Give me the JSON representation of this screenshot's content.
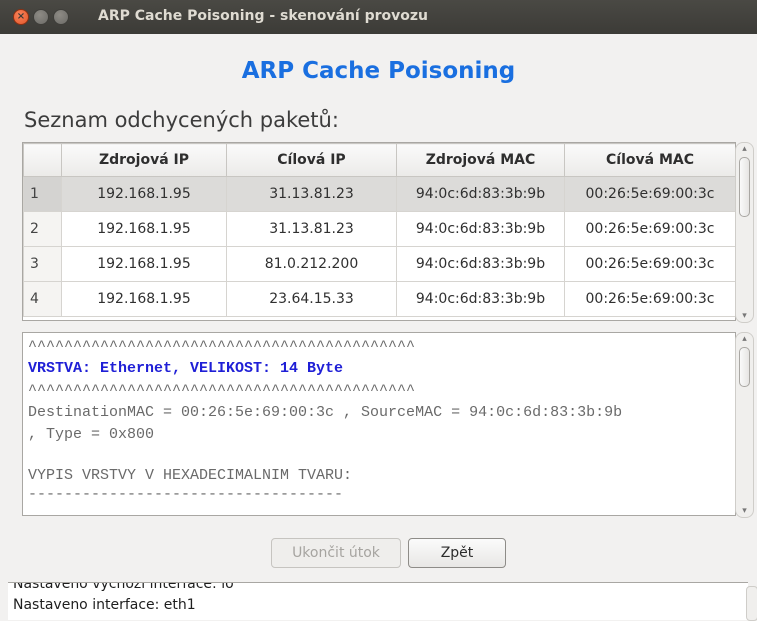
{
  "window": {
    "title": "ARP Cache Poisoning - skenování provozu",
    "close_glyph": "×"
  },
  "app_title": "ARP Cache Poisoning",
  "packets_label": "Seznam odchycených paketů:",
  "table": {
    "columns": [
      "",
      "Zdrojová IP",
      "Cílová IP",
      "Zdrojová MAC",
      "Cílová MAC"
    ],
    "rows": [
      {
        "index": "1",
        "src_ip": "192.168.1.95",
        "dst_ip": "31.13.81.23",
        "src_mac": "94:0c:6d:83:3b:9b",
        "dst_mac": "00:26:5e:69:00:3c",
        "selected": true
      },
      {
        "index": "2",
        "src_ip": "192.168.1.95",
        "dst_ip": "31.13.81.23",
        "src_mac": "94:0c:6d:83:3b:9b",
        "dst_mac": "00:26:5e:69:00:3c",
        "selected": false
      },
      {
        "index": "3",
        "src_ip": "192.168.1.95",
        "dst_ip": "81.0.212.200",
        "src_mac": "94:0c:6d:83:3b:9b",
        "dst_mac": "00:26:5e:69:00:3c",
        "selected": false
      },
      {
        "index": "4",
        "src_ip": "192.168.1.95",
        "dst_ip": "23.64.15.33",
        "src_mac": "94:0c:6d:83:3b:9b",
        "dst_mac": "00:26:5e:69:00:3c",
        "selected": false
      }
    ]
  },
  "detail": {
    "sep1": "^^^^^^^^^^^^^^^^^^^^^^^^^^^^^^^^^^^^^^^^^^^",
    "layer": "VRSTVA: Ethernet, VELIKOST: 14 Byte",
    "sep2": "^^^^^^^^^^^^^^^^^^^^^^^^^^^^^^^^^^^^^^^^^^^",
    "mac_line": "DestinationMAC = 00:26:5e:69:00:3c , SourceMAC = 94:0c:6d:83:3b:9b",
    "type_line": ", Type = 0x800",
    "hex_heading": "VYPIS VRSTVY V HEXADECIMALNIM TVARU:",
    "dashes": "-----------------------------------"
  },
  "buttons": {
    "stop_attack": "Ukončit útok",
    "back": "Zpět"
  },
  "log": {
    "prev_line": "Nastaveno výchozí interface: lo",
    "current_line": "Nastaveno interface: eth1"
  },
  "colors": {
    "accent": "#1a6fe0",
    "highlight_text": "#1f1fd6",
    "selected_row": "#dcdbd9"
  }
}
